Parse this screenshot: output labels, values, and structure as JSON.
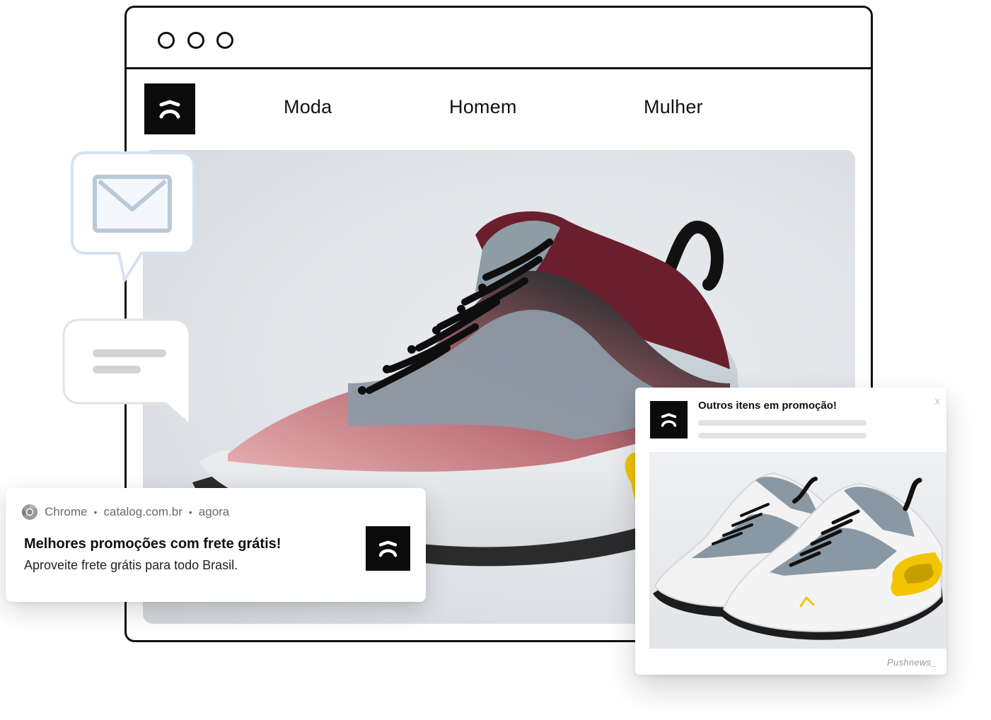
{
  "nav": {
    "items": [
      {
        "label": "Moda"
      },
      {
        "label": "Homem"
      },
      {
        "label": "Mulher"
      }
    ]
  },
  "hero": {
    "image": "sneaker-pink-gradient-photo"
  },
  "icons": {
    "left_bubble_top": "mail-icon",
    "left_bubble_bottom": "message-lines-icon"
  },
  "chrome_notification": {
    "app": "Chrome",
    "sep": "•",
    "domain": "catalog.com.br",
    "time": "agora",
    "title": "Melhores promoções com frete grátis!",
    "body": "Aproveite frete grátis para todo Brasil."
  },
  "push_notification": {
    "title": "Outros itens em promoção!",
    "close_label": "x",
    "image": "white-sneakers-pair-photo",
    "brand": "Pushnews_"
  },
  "colors": {
    "brand_black": "#0b0b0b",
    "accent_yellow": "#f2c500",
    "shoe_maroon": "#6b1f2c",
    "shoe_blue_gray": "#8c9aa5"
  }
}
